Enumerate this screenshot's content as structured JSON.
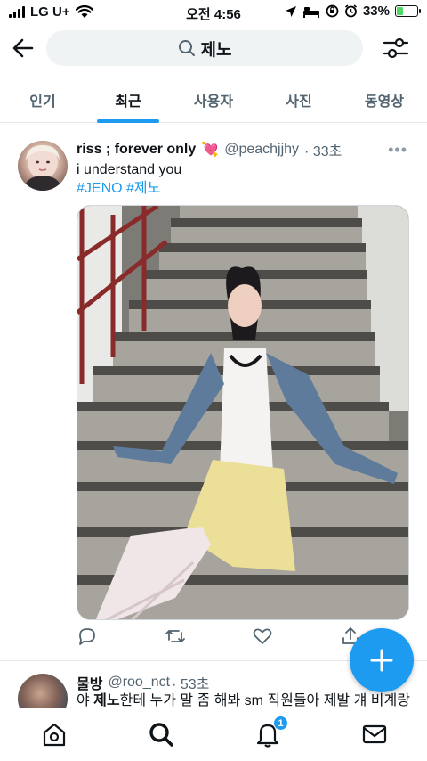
{
  "status_bar": {
    "carrier": "LG U+",
    "time": "오전 4:56",
    "battery_percent": "33%",
    "battery_level": 0.33
  },
  "search": {
    "query": "제노"
  },
  "tabs": [
    {
      "label": "인기",
      "active": false
    },
    {
      "label": "최근",
      "active": true
    },
    {
      "label": "사용자",
      "active": false
    },
    {
      "label": "사진",
      "active": false
    },
    {
      "label": "동영상",
      "active": false
    }
  ],
  "tweets": [
    {
      "name": "riss ; forever only",
      "name_emoji": "💘",
      "handle": "@peachjjhy",
      "time": "· 33초",
      "text": "i understand you",
      "hashtags": [
        "#JENO",
        "#제노"
      ],
      "media": "photo"
    },
    {
      "name": "물방",
      "handle": "@roo_nct",
      "time": "· 53초",
      "text_prefix": "야 ",
      "text_highlight": "제노",
      "text_suffix": "한테 누가 말 좀 해봐 sm 직원들아 제발 걔 비계랑"
    }
  ],
  "bottom_nav": {
    "notification_count": "1"
  },
  "colors": {
    "accent": "#1d9bf0",
    "secondary_text": "#536471",
    "battery_fill": "#4cd964"
  },
  "icons": [
    "back-arrow-icon",
    "search-icon",
    "settings-sliders-icon",
    "more-icon",
    "reply-icon",
    "retweet-icon",
    "like-icon",
    "share-icon",
    "compose-plus-icon",
    "home-icon",
    "explore-search-icon",
    "notifications-bell-icon",
    "messages-mail-icon"
  ]
}
